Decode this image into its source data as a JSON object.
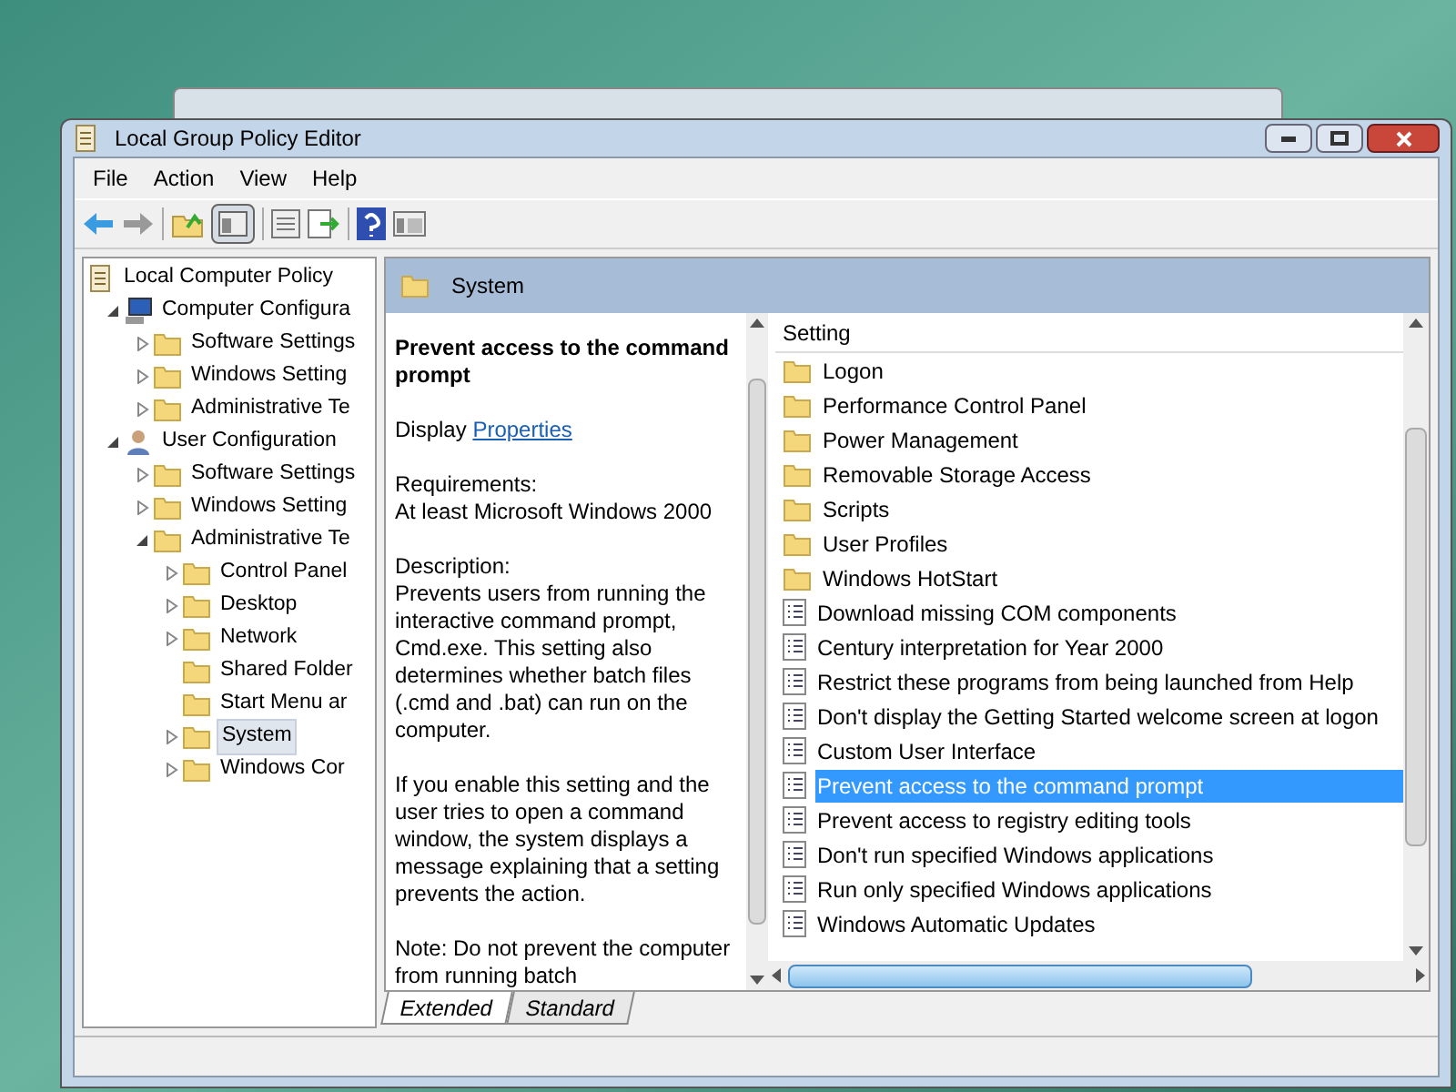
{
  "window": {
    "title": "Local Group Policy Editor"
  },
  "menu": [
    "File",
    "Action",
    "View",
    "Help"
  ],
  "tree": [
    {
      "label": "Local Computer Policy",
      "kind": "policy",
      "selected": false,
      "children": [
        {
          "label": "Computer Configura",
          "kind": "computer",
          "expanded": true,
          "selected": false,
          "children": [
            {
              "label": "Software Settings",
              "kind": "folder",
              "expanded": false,
              "selected": false
            },
            {
              "label": "Windows Setting",
              "kind": "folder",
              "expanded": false,
              "selected": false
            },
            {
              "label": "Administrative Te",
              "kind": "folder",
              "expanded": false,
              "selected": false
            }
          ]
        },
        {
          "label": "User Configuration",
          "kind": "user",
          "expanded": true,
          "selected": false,
          "children": [
            {
              "label": "Software Settings",
              "kind": "folder",
              "expanded": false,
              "selected": false
            },
            {
              "label": "Windows Setting",
              "kind": "folder",
              "expanded": false,
              "selected": false
            },
            {
              "label": "Administrative Te",
              "kind": "folder",
              "expanded": true,
              "selected": false,
              "children": [
                {
                  "label": "Control Panel",
                  "kind": "folder",
                  "expanded": false,
                  "selected": false
                },
                {
                  "label": "Desktop",
                  "kind": "folder",
                  "expanded": false,
                  "selected": false
                },
                {
                  "label": "Network",
                  "kind": "folder",
                  "expanded": false,
                  "selected": false
                },
                {
                  "label": "Shared Folder",
                  "kind": "folder",
                  "selected": false
                },
                {
                  "label": "Start Menu ar",
                  "kind": "folder",
                  "selected": false
                },
                {
                  "label": "System",
                  "kind": "folder",
                  "expanded": false,
                  "selected": true
                },
                {
                  "label": "Windows Cor",
                  "kind": "folder",
                  "expanded": false,
                  "selected": false
                }
              ]
            }
          ]
        }
      ]
    }
  ],
  "pane_header": "System",
  "description": {
    "title": "Prevent access to the command prompt",
    "display_label": "Display",
    "display_link": "Properties",
    "paragraphs": [
      "Requirements:\nAt least Microsoft Windows 2000",
      "Description:\nPrevents users from running the interactive command prompt, Cmd.exe. This setting also determines whether batch files (.cmd and .bat) can run on the computer.",
      "If you enable this setting and the user tries to open a command window, the system displays a message explaining that a setting prevents the action.",
      "Note: Do not prevent the computer from running batch"
    ]
  },
  "list": {
    "column": "Setting",
    "rows": [
      {
        "label": "Logon",
        "kind": "folder",
        "selected": false
      },
      {
        "label": "Performance Control Panel",
        "kind": "folder",
        "selected": false
      },
      {
        "label": "Power Management",
        "kind": "folder",
        "selected": false
      },
      {
        "label": "Removable Storage Access",
        "kind": "folder",
        "selected": false
      },
      {
        "label": "Scripts",
        "kind": "folder",
        "selected": false
      },
      {
        "label": "User Profiles",
        "kind": "folder",
        "selected": false
      },
      {
        "label": "Windows HotStart",
        "kind": "folder",
        "selected": false
      },
      {
        "label": "Download missing COM components",
        "kind": "setting",
        "selected": false
      },
      {
        "label": "Century interpretation for Year 2000",
        "kind": "setting",
        "selected": false
      },
      {
        "label": "Restrict these programs from being launched from Help",
        "kind": "setting",
        "selected": false
      },
      {
        "label": "Don't display the Getting Started welcome screen at logon",
        "kind": "setting",
        "selected": false
      },
      {
        "label": "Custom User Interface",
        "kind": "setting",
        "selected": false
      },
      {
        "label": "Prevent access to the command prompt",
        "kind": "setting",
        "selected": true
      },
      {
        "label": "Prevent access to registry editing tools",
        "kind": "setting",
        "selected": false
      },
      {
        "label": "Don't run specified Windows applications",
        "kind": "setting",
        "selected": false
      },
      {
        "label": "Run only specified Windows applications",
        "kind": "setting",
        "selected": false
      },
      {
        "label": "Windows Automatic Updates",
        "kind": "setting",
        "selected": false
      }
    ]
  },
  "tabs": [
    {
      "label": "Extended",
      "selected": true
    },
    {
      "label": "Standard",
      "selected": false
    }
  ]
}
